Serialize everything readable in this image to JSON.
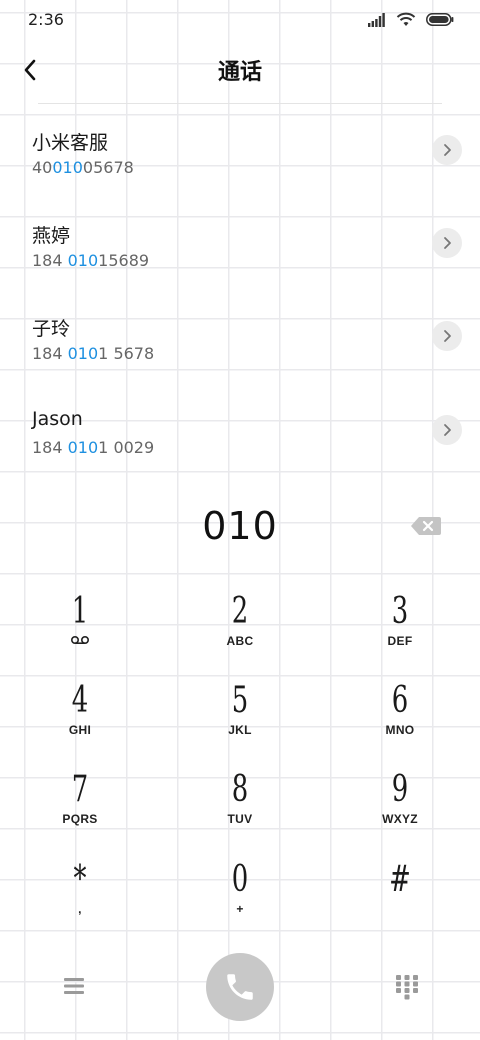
{
  "status_bar": {
    "time": "2:36",
    "icons": [
      "signal-icon",
      "wifi-icon",
      "battery-icon"
    ]
  },
  "header": {
    "back_icon": "chevron-left-icon",
    "title": "通话"
  },
  "contacts": [
    {
      "name": "小米客服",
      "number_parts": [
        "40",
        "010",
        "05678"
      ]
    },
    {
      "name": "燕婷",
      "number_parts": [
        "184 ",
        "010",
        "15689"
      ]
    },
    {
      "name": "子玲",
      "number_parts": [
        "184 ",
        "010",
        "1 5678"
      ]
    },
    {
      "name": "Jason",
      "number_parts": [
        "184 ",
        "010",
        "1 0029"
      ]
    }
  ],
  "dial": {
    "number": "010",
    "backspace_icon": "backspace-icon"
  },
  "keypad": [
    {
      "digit": "1",
      "sub": "",
      "sub_icon": "voicemail-icon"
    },
    {
      "digit": "2",
      "sub": "ABC"
    },
    {
      "digit": "3",
      "sub": "DEF"
    },
    {
      "digit": "4",
      "sub": "GHI"
    },
    {
      "digit": "5",
      "sub": "JKL"
    },
    {
      "digit": "6",
      "sub": "MNO"
    },
    {
      "digit": "7",
      "sub": "PQRS"
    },
    {
      "digit": "8",
      "sub": "TUV"
    },
    {
      "digit": "9",
      "sub": "WXYZ"
    },
    {
      "digit": "*",
      "sub": ","
    },
    {
      "digit": "0",
      "sub": "+"
    },
    {
      "digit": "#",
      "sub": ""
    }
  ],
  "bottom_bar": {
    "menu_icon": "menu-icon",
    "call_icon": "phone-icon",
    "dialpad_icon": "dialpad-icon"
  },
  "colors": {
    "highlight": "#1e90e0",
    "call_button": "#c8c8c8",
    "grid": "#e9e9ec"
  }
}
